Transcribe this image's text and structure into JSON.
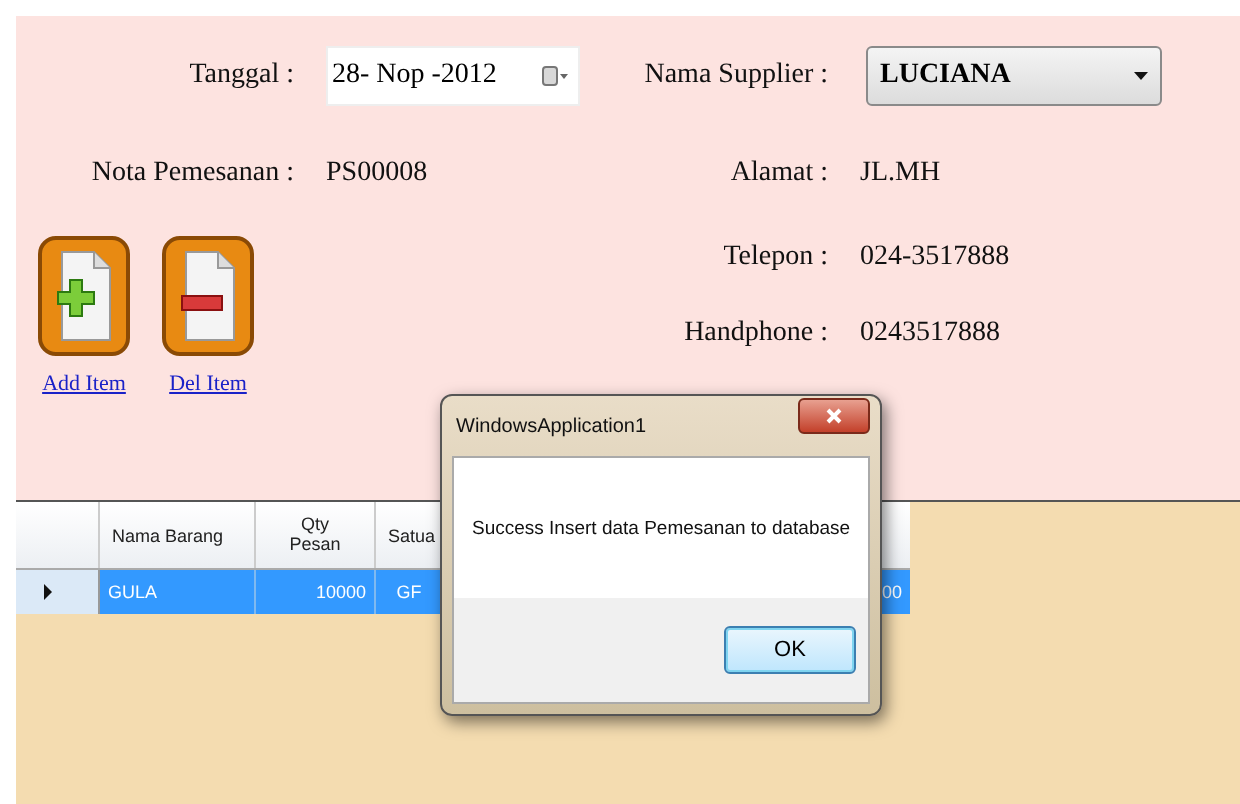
{
  "form": {
    "tanggal_label": "Tanggal :",
    "tanggal_value": "28- Nop -2012",
    "nota_label": "Nota Pemesanan :",
    "nota_value": "PS00008",
    "supplier_label": "Nama Supplier :",
    "supplier_value": "LUCIANA",
    "alamat_label": "Alamat :",
    "alamat_value": "JL.MH",
    "telepon_label": "Telepon :",
    "telepon_value": "024-3517888",
    "handphone_label": "Handphone :",
    "handphone_value": "0243517888"
  },
  "actions": [
    {
      "kind": "add",
      "label": "Add Item"
    },
    {
      "kind": "del",
      "label": "Del Item"
    }
  ],
  "grid": {
    "columns": [
      "Nama Barang",
      "Qty\nPesan",
      "Satua"
    ],
    "rows": [
      {
        "selected": true,
        "cells": [
          "GULA",
          "10000",
          "GF",
          "00"
        ]
      }
    ]
  },
  "dialog": {
    "title": "WindowsApplication1",
    "message": "Success Insert data Pemesanan to database",
    "button": "OK"
  }
}
